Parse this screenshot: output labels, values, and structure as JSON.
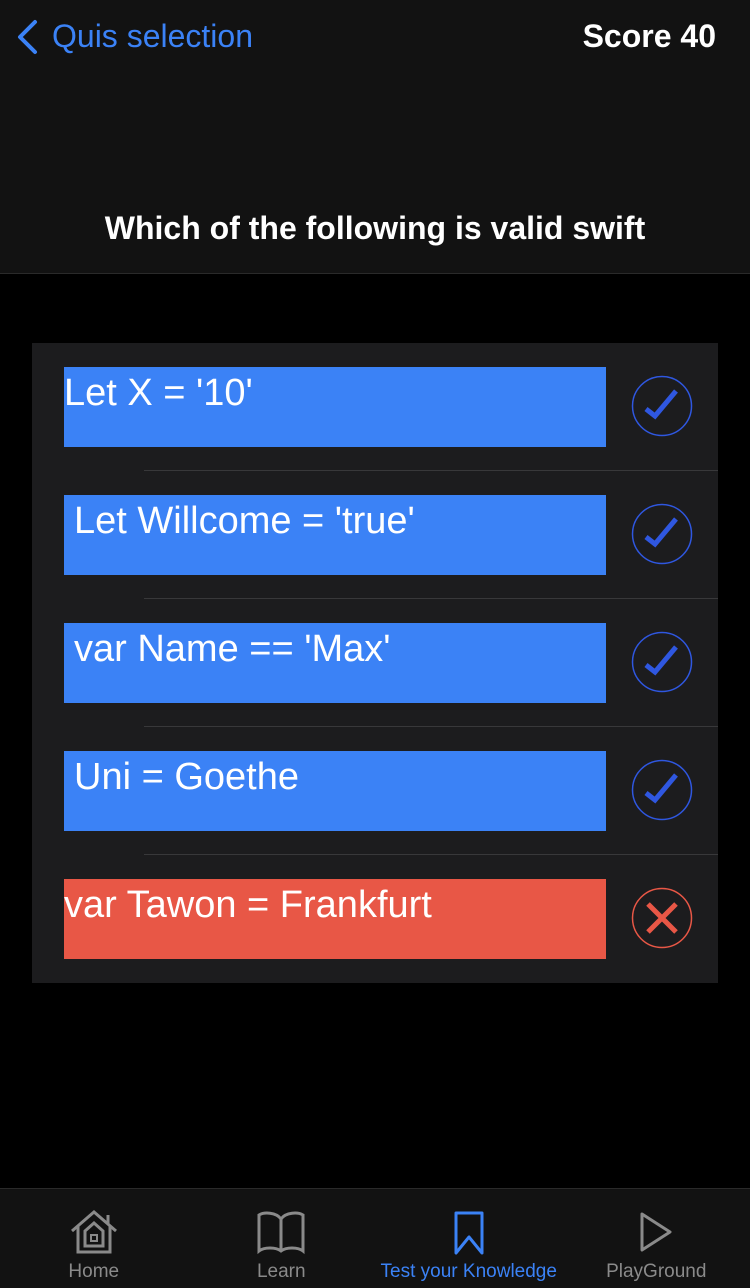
{
  "header": {
    "back_label": "Quis selection",
    "score": "Score 40",
    "question": "Which of the following is valid swift"
  },
  "answers": [
    {
      "text": "Let X = '10'",
      "status": "correct",
      "color": "#3b82f6",
      "indent": false
    },
    {
      "text": "Let Willcome = 'true'",
      "status": "correct",
      "color": "#3b82f6",
      "indent": true
    },
    {
      "text": "var Name == 'Max'",
      "status": "correct",
      "color": "#3b82f6",
      "indent": true
    },
    {
      "text": "Uni = Goethe",
      "status": "correct",
      "color": "#3b82f6",
      "indent": true
    },
    {
      "text": "var Tawon = Frankfurt",
      "status": "wrong",
      "color": "#e85746",
      "indent": false
    }
  ],
  "tabs": [
    {
      "label": "Home",
      "icon": "home-icon"
    },
    {
      "label": "Learn",
      "icon": "book-icon"
    },
    {
      "label": "Test your Knowledge",
      "icon": "bookmark-icon",
      "active": true
    },
    {
      "label": "PlayGround",
      "icon": "play-icon"
    }
  ]
}
